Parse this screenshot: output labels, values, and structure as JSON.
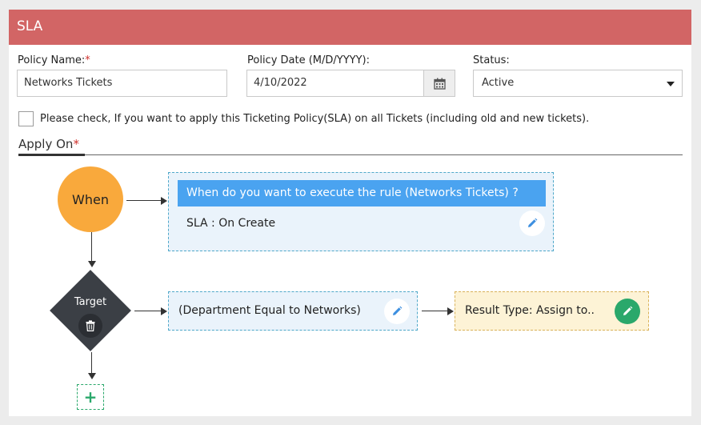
{
  "header": {
    "title": "SLA"
  },
  "form": {
    "policy_name_label": "Policy Name:",
    "required_mark": "*",
    "policy_name_value": "Networks Tickets",
    "policy_date_label": "Policy Date (M/D/YYYY):",
    "policy_date_value": "4/10/2022",
    "status_label": "Status:",
    "status_value": "Active",
    "apply_all_label": "Please check, If you want to apply this Ticketing Policy(SLA) on all Tickets (including old and new tickets)."
  },
  "apply_on": {
    "title": "Apply On",
    "required_mark": "*"
  },
  "flow": {
    "when_label": "When",
    "when_box_title": "When do you want to execute the rule (Networks Tickets) ?",
    "when_box_value": "SLA : On Create",
    "target_label": "Target",
    "condition_text": "(Department Equal to Networks)",
    "result_text": "Result Type: Assign to..",
    "add_symbol": "+"
  },
  "colors": {
    "header_bg": "#d26565",
    "when_circle": "#f9a93c",
    "rule_head": "#4aa3f0",
    "target_diamond": "#3b3f45",
    "result_box": "#fdf3d6",
    "accent_green": "#2aa86b"
  },
  "icons": {
    "calendar": "calendar-icon",
    "select_caret": "caret-down-icon",
    "edit": "pencil-icon",
    "delete": "trash-icon",
    "add": "plus-icon"
  }
}
